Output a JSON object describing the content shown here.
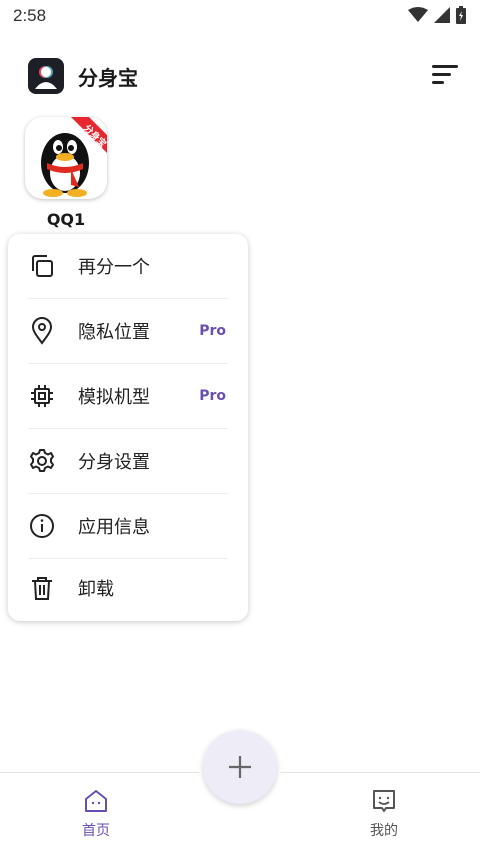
{
  "status_bar": {
    "time": "2:58"
  },
  "header": {
    "title": "分身宝"
  },
  "app": {
    "name": "QQ1",
    "badge": "分身宝"
  },
  "menu": {
    "items": [
      {
        "label": "再分一个",
        "icon": "copy-icon",
        "pro": ""
      },
      {
        "label": "隐私位置",
        "icon": "location-pin-icon",
        "pro": "Pro"
      },
      {
        "label": "模拟机型",
        "icon": "chip-icon",
        "pro": "Pro"
      },
      {
        "label": "分身设置",
        "icon": "gear-icon",
        "pro": ""
      },
      {
        "label": "应用信息",
        "icon": "info-icon",
        "pro": ""
      },
      {
        "label": "卸载",
        "icon": "trash-icon",
        "pro": ""
      }
    ]
  },
  "bottom_nav": {
    "home_label": "首页",
    "mine_label": "我的",
    "active": "home"
  },
  "colors": {
    "accent": "#6a4fb1",
    "fab_bg": "#eeecf6"
  }
}
